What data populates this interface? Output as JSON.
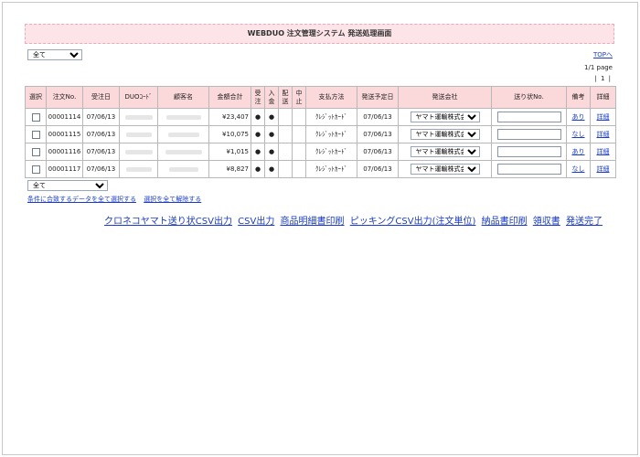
{
  "header": {
    "title": "WEBDUO 注文管理システム 発送処理画面"
  },
  "filter_top": {
    "selected": "全て"
  },
  "filter_bottom": {
    "selected": "全て"
  },
  "top_link": "TOPへ",
  "pager": {
    "info": "1/1 page",
    "nav": "| 1 |"
  },
  "columns": {
    "select": "選択",
    "order_no": "注文No.",
    "order_date": "受注日",
    "duo_code": "DUOｺｰﾄﾞ",
    "customer": "顧客名",
    "total": "金額合計",
    "received_1": "受",
    "received_2": "注",
    "paid_1": "入",
    "paid_2": "金",
    "ship_1": "配",
    "ship_2": "送",
    "stop_1": "中",
    "stop_2": "止",
    "payment": "支払方法",
    "ship_date": "発送予定日",
    "carrier": "発送会社",
    "tracking": "送り状No.",
    "remarks": "備考",
    "detail": "詳細"
  },
  "rows": [
    {
      "order_no": "00001114",
      "order_date": "07/06/13",
      "total": "¥23,407",
      "received": "●",
      "paid": "●",
      "payment": "ｸﾚｼﾞｯﾄｶｰﾄﾞ",
      "ship_date": "07/06/13",
      "carrier": "ヤマト運輸株式会社",
      "remarks": "あり",
      "detail": "詳細"
    },
    {
      "order_no": "00001115",
      "order_date": "07/06/13",
      "total": "¥10,075",
      "received": "●",
      "paid": "●",
      "payment": "ｸﾚｼﾞｯﾄｶｰﾄﾞ",
      "ship_date": "07/06/13",
      "carrier": "ヤマト運輸株式会社",
      "remarks": "なし",
      "detail": "詳細"
    },
    {
      "order_no": "00001116",
      "order_date": "07/06/13",
      "total": "¥1,015",
      "received": "●",
      "paid": "●",
      "payment": "ｸﾚｼﾞｯﾄｶｰﾄﾞ",
      "ship_date": "07/06/13",
      "carrier": "ヤマト運輸株式会社",
      "remarks": "あり",
      "detail": "詳細"
    },
    {
      "order_no": "00001117",
      "order_date": "07/06/13",
      "total": "¥8,827",
      "received": "●",
      "paid": "●",
      "payment": "ｸﾚｼﾞｯﾄｶｰﾄﾞ",
      "ship_date": "07/06/13",
      "carrier": "ヤマト運輸株式会社",
      "remarks": "なし",
      "detail": "詳細"
    }
  ],
  "bulk": {
    "select_all": "条件に合致するデータを全て選択する",
    "deselect_all": "選択を全て解除する"
  },
  "actions": {
    "kuroneko_csv": "クロネコヤマト送り状CSV出力",
    "csv": "CSV出力",
    "delivery_note": "商品明細書印刷",
    "picking_csv": "ピッキングCSV出力(注文単位)",
    "invoice": "納品書印刷",
    "receipt": "領収書",
    "shipped": "発送完了"
  },
  "colors": {
    "header_bg": "#fde4e8",
    "link": "#1a3cc8"
  }
}
